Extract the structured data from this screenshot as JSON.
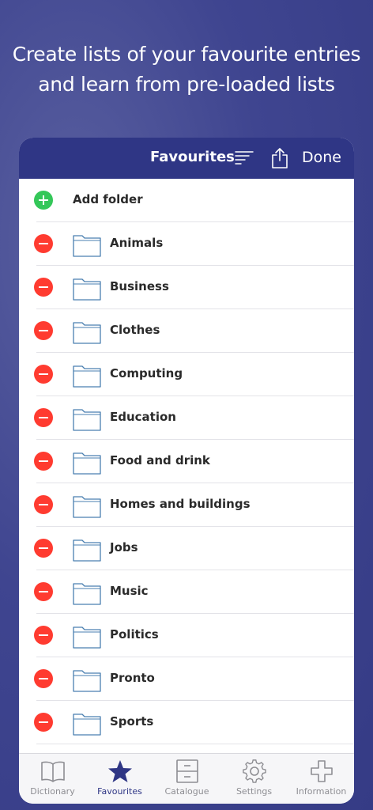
{
  "headline": {
    "line1": "Create lists of your favourite entries",
    "line2": "and learn from pre-loaded lists"
  },
  "navbar": {
    "title": "Favourites",
    "done_label": "Done",
    "sort_icon": "sort-lines-icon",
    "share_icon": "share-icon"
  },
  "list": {
    "add_label": "Add folder",
    "folders": [
      "Animals",
      "Business",
      "Clothes",
      "Computing",
      "Education",
      "Food and drink",
      "Homes and buildings",
      "Jobs",
      "Music",
      "Politics",
      "Pronto",
      "Sports"
    ]
  },
  "tabs": [
    {
      "label": "Dictionary",
      "icon": "book-icon",
      "active": false
    },
    {
      "label": "Favourites",
      "icon": "star-icon",
      "active": true
    },
    {
      "label": "Catalogue",
      "icon": "cabinet-icon",
      "active": false
    },
    {
      "label": "Settings",
      "icon": "gear-icon",
      "active": false
    },
    {
      "label": "Information",
      "icon": "cross-icon",
      "active": false
    }
  ],
  "colors": {
    "navbar": "#2f3685",
    "add": "#34c759",
    "delete": "#ff3b30",
    "folder_stroke": "#4a7fb0",
    "tab_active": "#2f3685",
    "tab_inactive": "#8e8e93"
  }
}
